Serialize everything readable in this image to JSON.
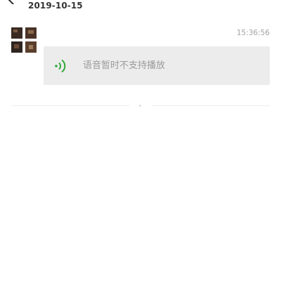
{
  "header": {
    "back_icon": "chevron-left-icon",
    "date": "2019-10-15"
  },
  "message": {
    "avatar_icon": "avatar-image",
    "timestamp": "15:36:56",
    "voice": {
      "icon": "voice-wave-icon",
      "icon_color": "#2fa83a",
      "text": "语音暂时不支持播放"
    }
  },
  "colors": {
    "bubble_background": "#ececec",
    "secondary_text": "#9b9b9b",
    "date_text": "#333333"
  }
}
